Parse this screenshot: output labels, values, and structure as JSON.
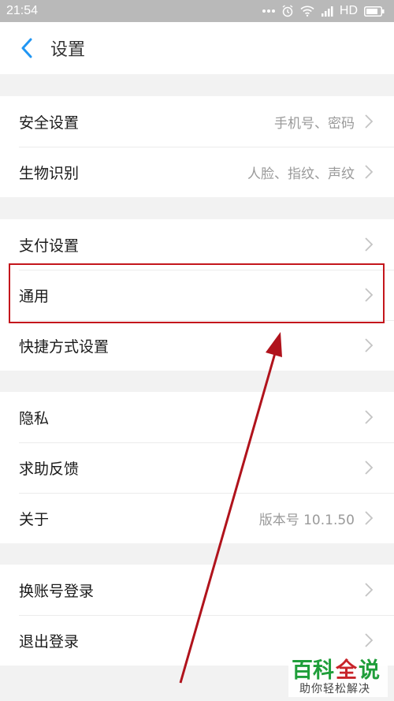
{
  "status_bar": {
    "time": "21:54",
    "signal_type": "HD",
    "icons": [
      "more-dots-icon",
      "alarm-icon",
      "wifi-icon",
      "signal-icon"
    ]
  },
  "header": {
    "title": "设置"
  },
  "groups": [
    [
      {
        "label": "安全设置",
        "value": "手机号、密码"
      },
      {
        "label": "生物识别",
        "value": "人脸、指纹、声纹"
      }
    ],
    [
      {
        "label": "支付设置",
        "value": ""
      },
      {
        "label": "通用",
        "value": ""
      },
      {
        "label": "快捷方式设置",
        "value": ""
      }
    ],
    [
      {
        "label": "隐私",
        "value": ""
      },
      {
        "label": "求助反馈",
        "value": ""
      },
      {
        "label": "关于",
        "value": "版本号 10.1.50"
      }
    ],
    [
      {
        "label": "换账号登录",
        "value": ""
      },
      {
        "label": "退出登录",
        "value": ""
      }
    ]
  ],
  "watermark": {
    "line1_green": "百科",
    "line1_red": "全",
    "line1_green2": "说",
    "line2": "助你轻松解决"
  },
  "colors": {
    "accent": "#2196f3",
    "highlight": "#c4161c",
    "arrow": "#b0131c",
    "watermark_green": "#1f9e3a",
    "watermark_red": "#c8242a"
  }
}
